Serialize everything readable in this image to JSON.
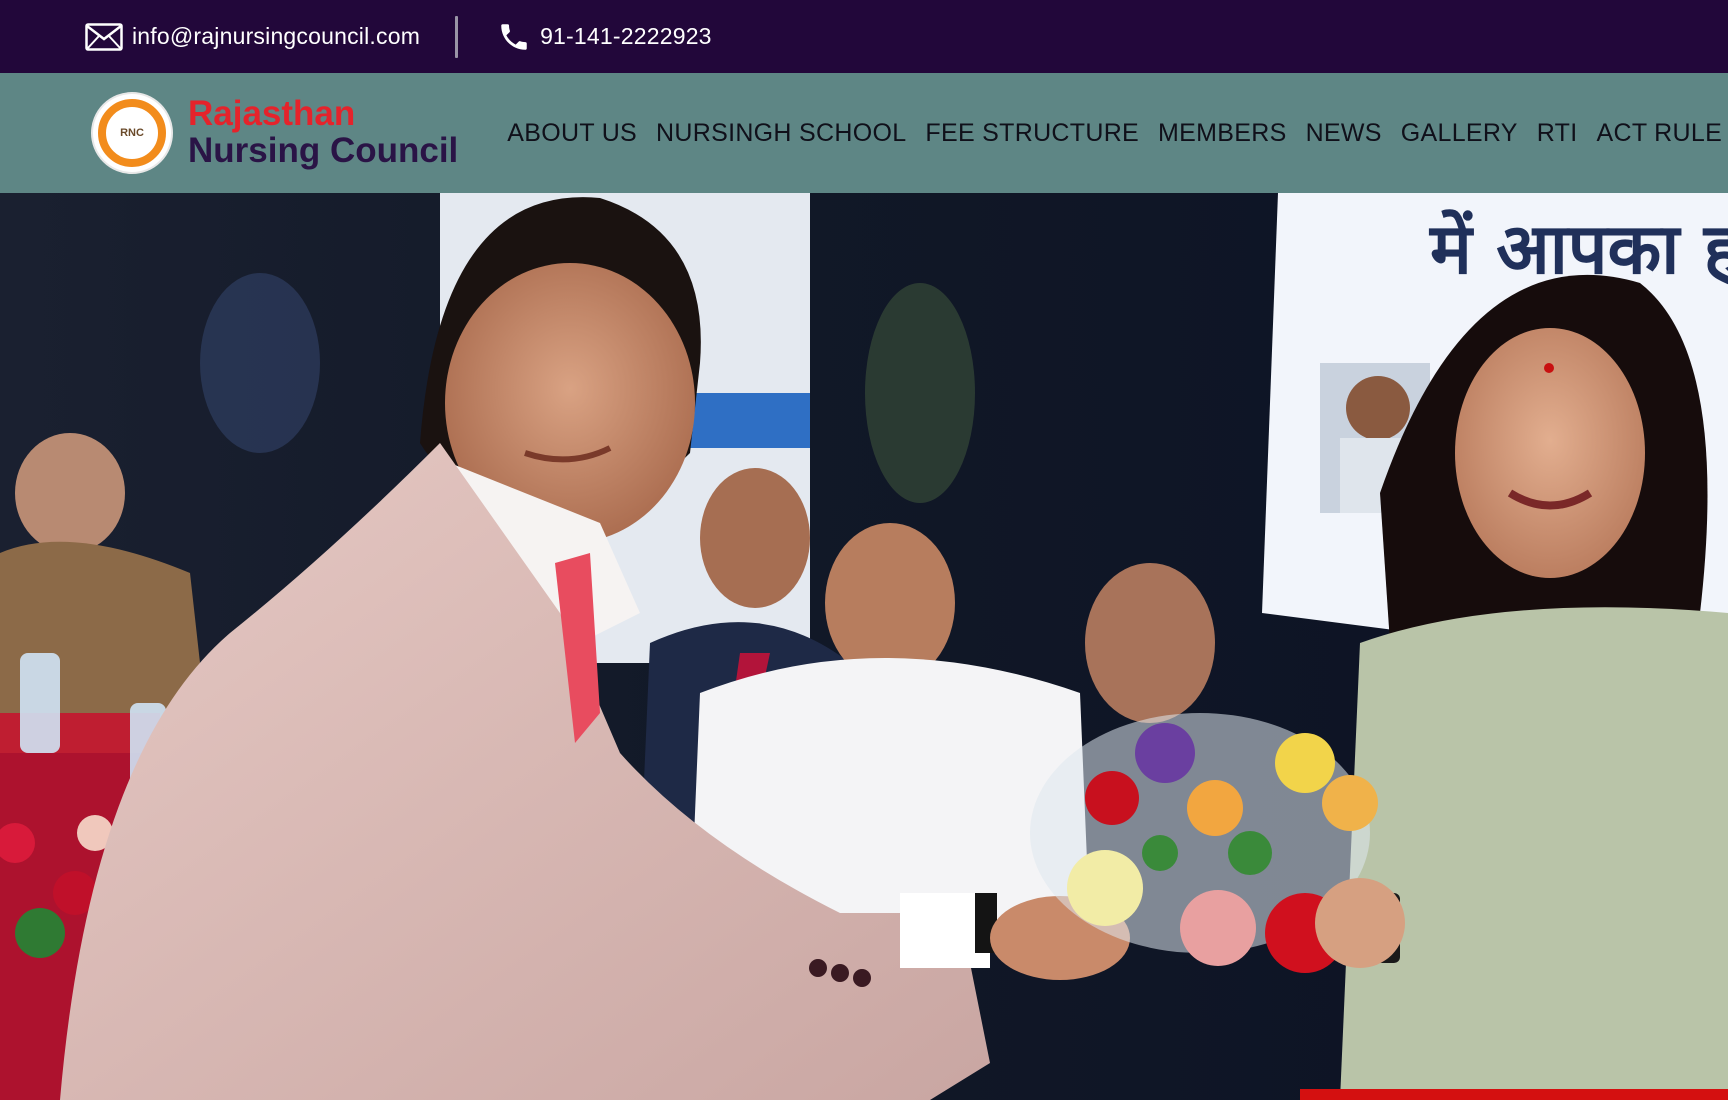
{
  "topbar": {
    "email": "info@rajnursingcouncil.com",
    "phone": "91-141-2222923",
    "email_icon": "envelope-icon",
    "phone_icon": "phone-icon"
  },
  "brand": {
    "line1": "Rajasthan",
    "line2": "Nursing Council",
    "logo_text": "RNC"
  },
  "nav": {
    "items": [
      {
        "label": "ABOUT US"
      },
      {
        "label": "NURSINGH SCHOOL"
      },
      {
        "label": "FEE STRUCTURE"
      },
      {
        "label": "MEMBERS"
      },
      {
        "label": "NEWS"
      },
      {
        "label": "GALLERY"
      },
      {
        "label": "RTI"
      },
      {
        "label": "ACT RULE"
      }
    ]
  },
  "hero": {
    "banner_text": "में आपका हा"
  },
  "colors": {
    "topbar_bg": "#22073a",
    "navbar_bg": "#5e8685",
    "brand_red": "#e5232b",
    "brand_purple": "#2a1446",
    "logo_orange": "#f28c1c"
  }
}
